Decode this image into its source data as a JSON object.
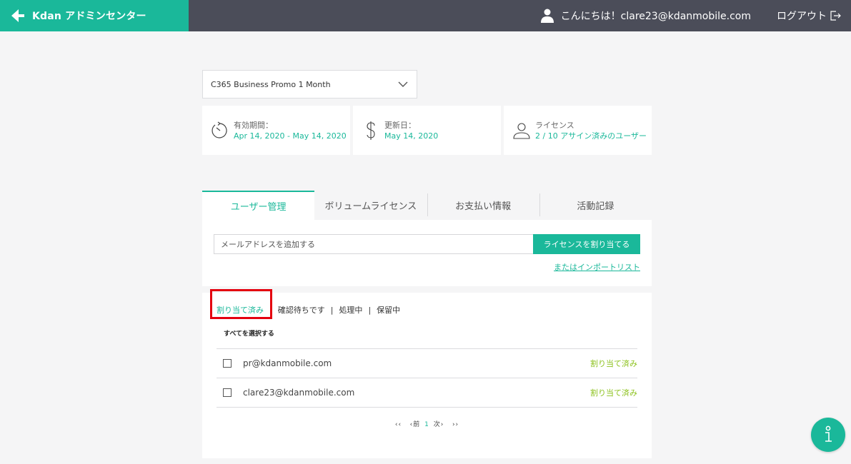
{
  "header": {
    "brand": "Kdan アドミンセンター",
    "greeting": "こんにちは！clare23@kdanmobile.com",
    "logout": "ログアウト"
  },
  "plan": {
    "selected": "C365 Business Promo 1 Month"
  },
  "cards": [
    {
      "icon": "clock-icon",
      "label": "有効期間：",
      "value": "Apr 14, 2020 - May 14, 2020"
    },
    {
      "icon": "dollar-icon",
      "label": "更新日：",
      "value": "May 14, 2020"
    },
    {
      "icon": "user-outline-icon",
      "label": "ライセンス",
      "value": "2 / 10 アサイン済みのユーザー"
    }
  ],
  "tabs": [
    "ユーザー管理",
    "ボリュームライセンス",
    "お支払い情報",
    "活動記録"
  ],
  "active_tab": 0,
  "assign": {
    "placeholder": "メールアドレスを追加する",
    "button": "ライセンスを割り当てる",
    "import_link": "またはインポートリスト"
  },
  "filters": [
    "割り当て済み",
    "確認待ちです",
    "処理中",
    "保留中"
  ],
  "separator": "|",
  "select_all": "すべてを選択する",
  "users": [
    {
      "email": "pr@kdanmobile.com",
      "status": "割り当て済み"
    },
    {
      "email": "clare23@kdanmobile.com",
      "status": "割り当て済み"
    }
  ],
  "pagination": {
    "first": "‹‹",
    "prev": "‹前",
    "current": "1",
    "next": "次›",
    "last": "››"
  },
  "colors": {
    "accent": "#1ab89a",
    "header": "#4b4d59",
    "status": "#8dc21f",
    "highlight": "#e4000f"
  }
}
